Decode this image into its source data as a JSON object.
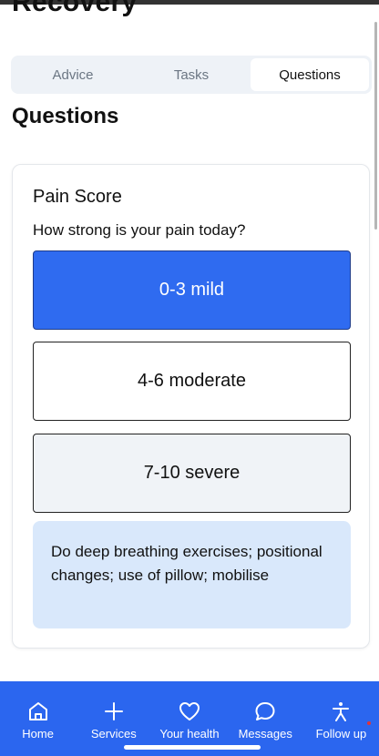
{
  "header": {
    "title": "Recovery"
  },
  "tabs": [
    {
      "label": "Advice",
      "active": false
    },
    {
      "label": "Tasks",
      "active": false
    },
    {
      "label": "Questions",
      "active": true
    }
  ],
  "section": {
    "title": "Questions"
  },
  "card": {
    "title": "Pain Score",
    "question": "How strong is your pain today?",
    "options": [
      {
        "label": "0-3 mild",
        "selected": true
      },
      {
        "label": "4-6 moderate",
        "selected": false
      },
      {
        "label": "7-10 severe",
        "selected": false
      }
    ],
    "advice": "Do deep breathing exercises; positional changes; use of pillow; mobilise"
  },
  "nav": {
    "items": [
      {
        "label": "Home",
        "icon": "home-icon"
      },
      {
        "label": "Services",
        "icon": "plus-icon"
      },
      {
        "label": "Your health",
        "icon": "heart-icon"
      },
      {
        "label": "Messages",
        "icon": "chat-bubble-icon"
      },
      {
        "label": "Follow up",
        "icon": "person-icon"
      }
    ]
  },
  "colors": {
    "accent": "#2b66ef",
    "selected_option": "#2f6bf0",
    "advice_background": "#d9e8fb",
    "tab_background": "#eef2f7",
    "notification_dot": "#e0343a"
  }
}
